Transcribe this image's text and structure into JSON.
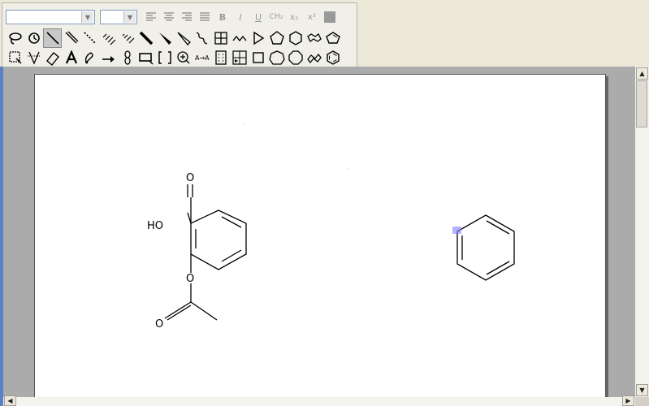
{
  "formatting_toolbar": {
    "font_name": "",
    "font_size": "",
    "subscript_ch2": "CH₂",
    "subscript_x": "x₂",
    "superscript_x": "x²",
    "bold": "B",
    "italic": "I",
    "underline": "U"
  },
  "structure": {
    "carbonyl_oxygen": "O",
    "hydroxyl": "HO",
    "ester_oxygen": "O",
    "acetyl_oxygen": "O"
  },
  "colors": {
    "window_bg": "#d4d0c8",
    "canvas_bg": "#ababab",
    "page_bg": "#ffffff",
    "selection_marker": "#8080ff"
  }
}
